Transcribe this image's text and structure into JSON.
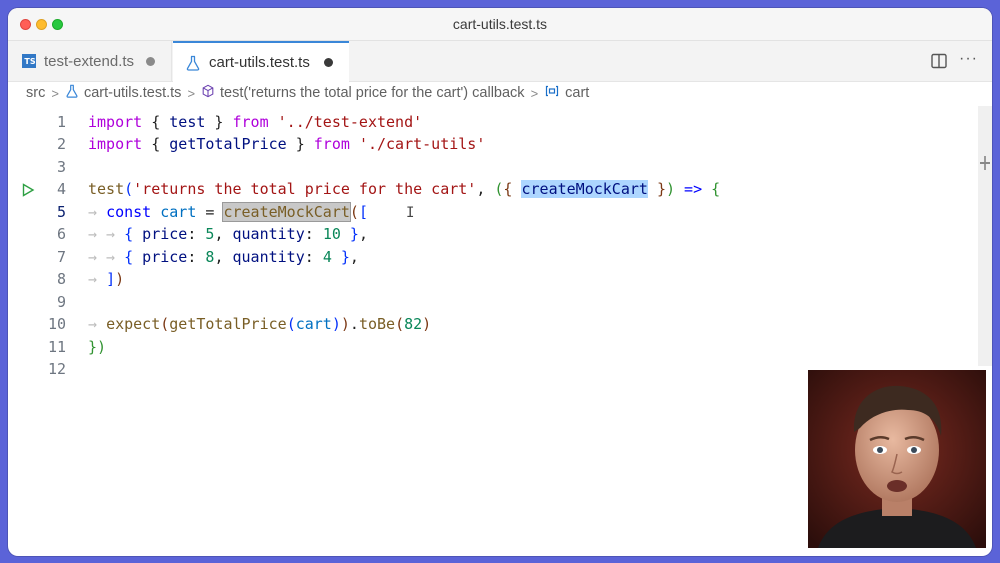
{
  "window": {
    "title": "cart-utils.test.ts"
  },
  "tabs": [
    {
      "label": "test-extend.ts",
      "icon": "ts-file-icon",
      "modified": true
    },
    {
      "label": "cart-utils.test.ts",
      "icon": "flask-icon",
      "modified": true,
      "active": true
    }
  ],
  "breadcrumb": {
    "items": [
      "src",
      "cart-utils.test.ts",
      "test('returns the total price for the cart') callback",
      "cart"
    ]
  },
  "editor": {
    "line_numbers": [
      "1",
      "2",
      "3",
      "4",
      "5",
      "6",
      "7",
      "8",
      "9",
      "10",
      "11",
      "12"
    ],
    "lines": {
      "l1": {
        "kw1": "import",
        "p1": " { ",
        "id1": "test",
        "p2": " } ",
        "kw2": "from",
        "sp": " ",
        "str": "'../test-extend'"
      },
      "l2": {
        "kw1": "import",
        "p1": " { ",
        "id1": "getTotalPrice",
        "p2": " } ",
        "kw2": "from",
        "sp": " ",
        "str": "'./cart-utils'"
      },
      "l4": {
        "fn": "test",
        "b1": "(",
        "str": "'returns the total price for the cart'",
        "p1": ", ",
        "b2": "(",
        "b3": "{",
        "sp1": " ",
        "param": "createMockCart",
        "sp2": " ",
        "b4": "}",
        "b5": ")",
        "arrow": " => ",
        "b6": "{"
      },
      "l5": {
        "kw": "const",
        "sp": " ",
        "var": "cart",
        "eq": " = ",
        "fn": "createMockCart",
        "b1": "(",
        "b2": "["
      },
      "l6": {
        "b1": "{",
        "k1": " price",
        "c1": ": ",
        "n1": "5",
        "c2": ", ",
        "k2": "quantity",
        "c3": ": ",
        "n2": "10",
        "sp": " ",
        "b2": "}",
        "comma": ","
      },
      "l7": {
        "b1": "{",
        "k1": " price",
        "c1": ": ",
        "n1": "8",
        "c2": ", ",
        "k2": "quantity",
        "c3": ": ",
        "n2": "4",
        "sp": " ",
        "b2": "}",
        "comma": ","
      },
      "l8": {
        "b1": "]",
        "b2": ")"
      },
      "l10": {
        "fn1": "expect",
        "b1": "(",
        "fn2": "getTotalPrice",
        "b2": "(",
        "var": "cart",
        "b3": ")",
        "b4": ")",
        "dot": ".",
        "fn3": "toBe",
        "b5": "(",
        "num": "82",
        "b6": ")"
      },
      "l11": {
        "b1": "}",
        "b2": ")"
      }
    }
  },
  "colors": {
    "keyword": "#af00db",
    "string": "#a31515",
    "function": "#795e26",
    "variable": "#001080",
    "number": "#098658",
    "tab_accent": "#3a87d8"
  }
}
